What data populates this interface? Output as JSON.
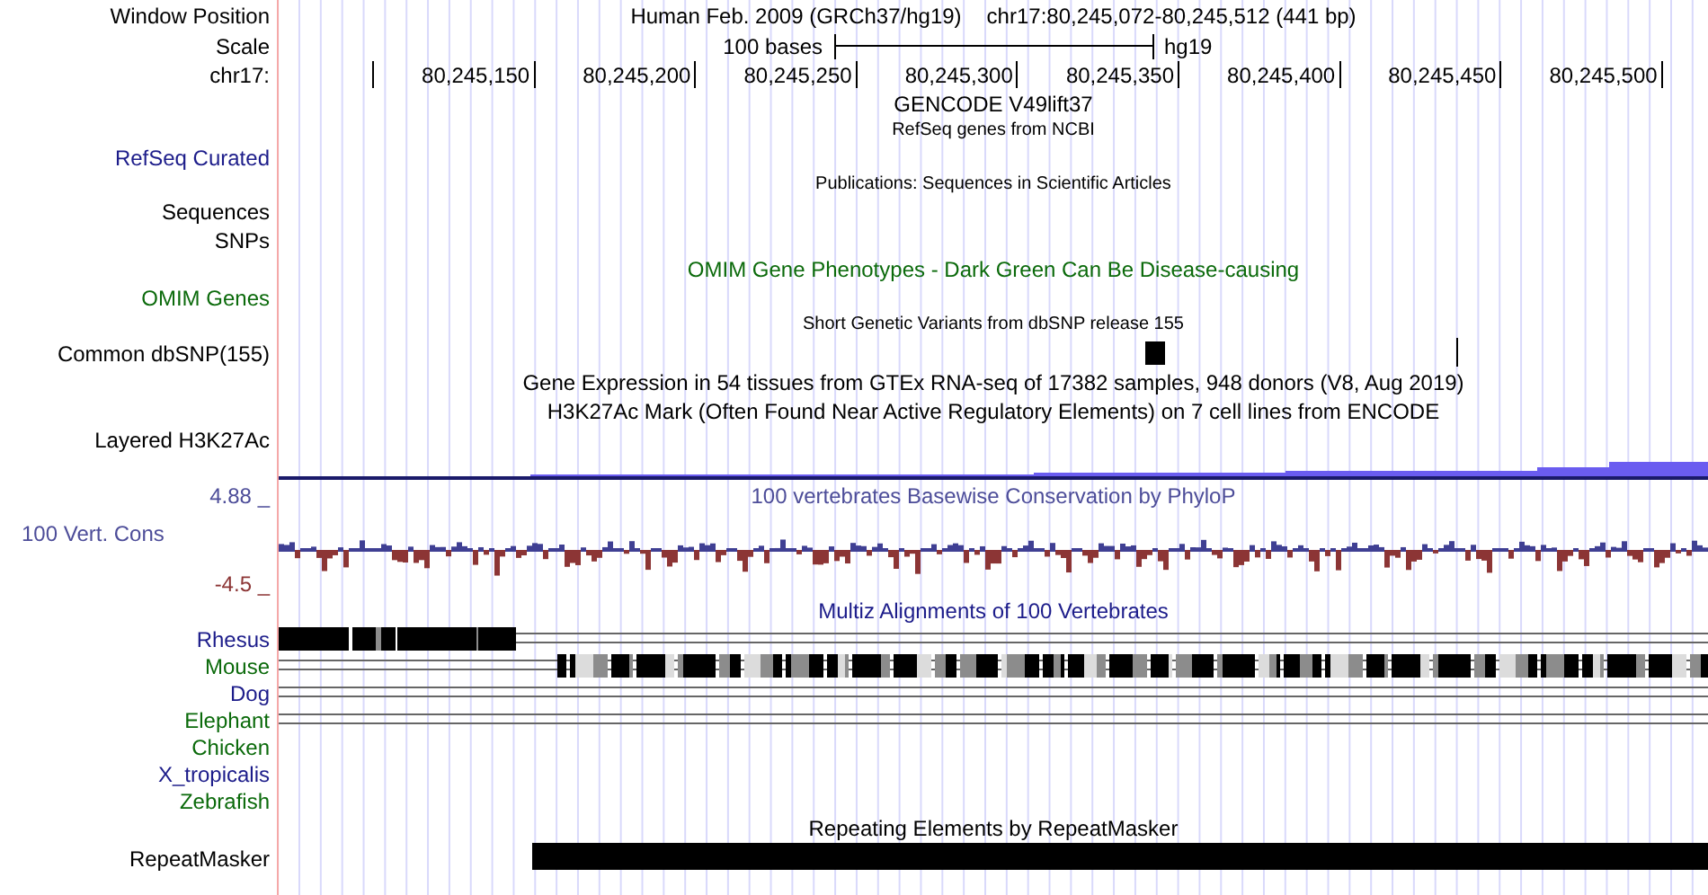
{
  "tracks": [
    {
      "kind": "position",
      "label": "Window Position",
      "text": "Human Feb. 2009 (GRCh37/hg19)",
      "text2": "chr17:80,245,072-80,245,512 (441 bp)"
    },
    {
      "kind": "scale",
      "label": "Scale",
      "text": "100 bases",
      "text2": "hg19"
    },
    {
      "kind": "ruler",
      "label": "chr17:",
      "ticks": [
        {
          "kind": "bare"
        },
        {
          "kind": "labeled",
          "label": "80,245,150"
        },
        {
          "kind": "labeled",
          "label": "80,245,200"
        },
        {
          "kind": "labeled",
          "label": "80,245,250"
        },
        {
          "kind": "labeled",
          "label": "80,245,300"
        },
        {
          "kind": "labeled",
          "label": "80,245,350"
        },
        {
          "kind": "labeled",
          "label": "80,245,400"
        },
        {
          "kind": "labeled",
          "label": "80,245,450"
        },
        {
          "kind": "labeled",
          "label": "80,245,500"
        }
      ]
    },
    {
      "kind": "title",
      "text": "GENCODE V49lift37",
      "color": "#000000"
    },
    {
      "kind": "subtitle",
      "text": "RefSeq genes from NCBI"
    },
    {
      "kind": "blank",
      "label": "RefSeq Curated",
      "color": "#1c1c8a"
    },
    {
      "kind": "subtitle",
      "text": "Publications: Sequences in Scientific Articles"
    },
    {
      "kind": "blank",
      "label": "Sequences",
      "color": "#000000"
    },
    {
      "kind": "blank",
      "label": "SNPs",
      "color": "#000000"
    },
    {
      "kind": "title",
      "text": "OMIM Gene Phenotypes - Dark Green Can Be Disease-causing",
      "color": "#0b6a0b"
    },
    {
      "kind": "blank",
      "label": "OMIM Genes",
      "color": "#0b6a0b"
    },
    {
      "kind": "subtitle",
      "text": "Short Genetic Variants from dbSNP release 155"
    },
    {
      "kind": "snps",
      "label": "Common dbSNP(155)",
      "color": "#000000"
    },
    {
      "kind": "title",
      "text": "Gene Expression in 54 tissues from GTEx RNA-seq of 17382 samples, 948 donors (V8, Aug 2019)",
      "color": "#000000"
    },
    {
      "kind": "title",
      "text": "H3K27Ac Mark (Often Found Near Active Regulatory Elements) on 7 cell lines from ENCODE",
      "color": "#000000"
    },
    {
      "kind": "blank",
      "label": "Layered H3K27Ac",
      "color": "#000000"
    },
    {
      "kind": "layered"
    },
    {
      "kind": "title",
      "label": "4.88 _",
      "color": "#4d4d99",
      "text": "100 vertebrates Basewise Conservation by PhyloP"
    },
    {
      "kind": "wiggle",
      "label": "100 Vert. Cons",
      "color": "#4d4d99",
      "min_label": "-4.5 _"
    },
    {
      "kind": "title",
      "text": "Multiz Alignments of 100 Vertebrates",
      "color": "#1c1c8a"
    },
    {
      "kind": "align_left",
      "label": "Rhesus",
      "color": "#1c1c8a"
    },
    {
      "kind": "align_right",
      "label": "Mouse",
      "color": "#0b6a0b"
    },
    {
      "kind": "align_lines",
      "label": "Dog",
      "color": "#1c1c8a"
    },
    {
      "kind": "align_lines",
      "label": "Elephant",
      "color": "#0b6a0b"
    },
    {
      "kind": "align_none",
      "label": "Chicken",
      "color": "#0b6a0b"
    },
    {
      "kind": "align_none",
      "label": "X_tropicalis",
      "color": "#1c1c8a"
    },
    {
      "kind": "align_none",
      "label": "Zebrafish",
      "color": "#0b6a0b"
    },
    {
      "kind": "title",
      "text": "Repeating Elements by RepeatMasker",
      "color": "#000000"
    },
    {
      "kind": "repeat",
      "label": "RepeatMasker",
      "color": "#000000"
    }
  ]
}
